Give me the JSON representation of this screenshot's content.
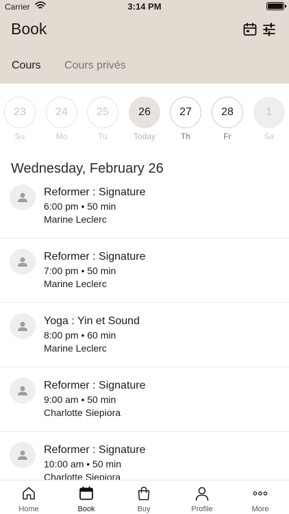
{
  "status": {
    "carrier": "Carrier",
    "time": "3:14 PM"
  },
  "header": {
    "title": "Book"
  },
  "tabs": {
    "cours": "Cours",
    "prives": "Cours privés"
  },
  "days": [
    {
      "num": "23",
      "label": "Su",
      "state": "past"
    },
    {
      "num": "24",
      "label": "Mo",
      "state": "past"
    },
    {
      "num": "25",
      "label": "Tu",
      "state": "past"
    },
    {
      "num": "26",
      "label": "Today",
      "state": "today"
    },
    {
      "num": "27",
      "label": "Th",
      "state": "active"
    },
    {
      "num": "28",
      "label": "Fr",
      "state": "active"
    },
    {
      "num": "1",
      "label": "Sa",
      "state": "full"
    }
  ],
  "date_heading": "Wednesday, February 26",
  "classes": [
    {
      "name": "Reformer : Signature",
      "time": "6:00 pm • 50 min",
      "teacher": "Marine Leclerc"
    },
    {
      "name": "Reformer : Signature",
      "time": "7:00 pm • 50 min",
      "teacher": "Marine Leclerc"
    },
    {
      "name": "Yoga : Yin et Sound",
      "time": "8:00 pm • 60 min",
      "teacher": "Marine Leclerc"
    },
    {
      "name": "Reformer : Signature",
      "time": "9:00 am • 50 min",
      "teacher": "Charlotte Siepiora"
    },
    {
      "name": "Reformer : Signature",
      "time": "10:00 am • 50 min",
      "teacher": "Charlotte Siepiora"
    }
  ],
  "tabbar": {
    "home": "Home",
    "book": "Book",
    "buy": "Buy",
    "profile": "Profile",
    "more": "More"
  },
  "colors": {
    "header_bg": "#e3dbd2",
    "today_bg": "#e6e3de"
  },
  "icons": {
    "calendar_button": "calendar-icon",
    "filter_button": "sliders-icon",
    "avatar": "person-icon",
    "home_tab": "home-icon",
    "book_tab": "calendar-icon",
    "buy_tab": "bag-icon",
    "profile_tab": "person-icon",
    "more_tab": "more-dots-icon"
  }
}
